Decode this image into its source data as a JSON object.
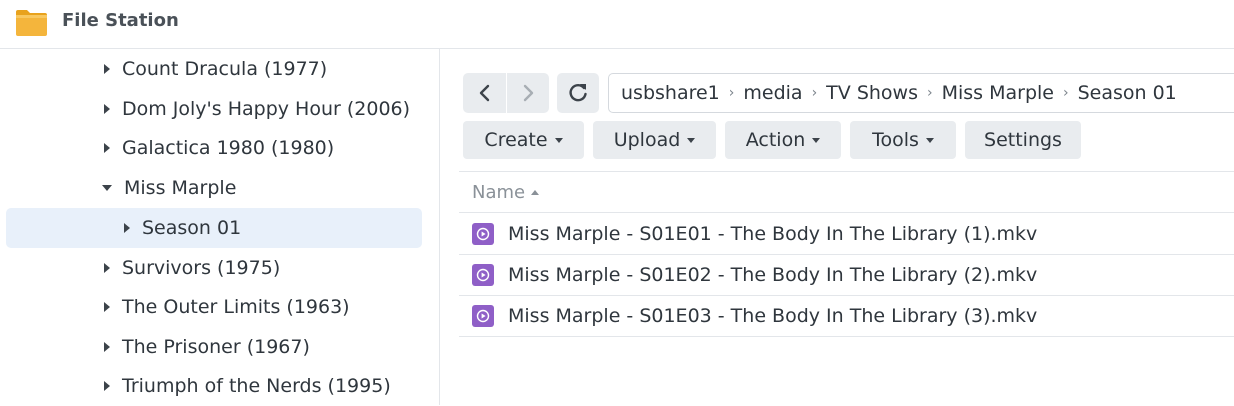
{
  "app": {
    "title": "File Station"
  },
  "tree": {
    "items": [
      {
        "label": "Count Dracula (1977)",
        "state": "collapsed"
      },
      {
        "label": "Dom Joly's Happy Hour (2006)",
        "state": "collapsed"
      },
      {
        "label": "Galactica 1980 (1980)",
        "state": "collapsed"
      },
      {
        "label": "Miss Marple",
        "state": "expanded"
      },
      {
        "label": "Season 01",
        "state": "collapsed",
        "selected": true
      },
      {
        "label": "Survivors (1975)",
        "state": "collapsed"
      },
      {
        "label": "The Outer Limits (1963)",
        "state": "collapsed"
      },
      {
        "label": "The Prisoner (1967)",
        "state": "collapsed"
      },
      {
        "label": "Triumph of the Nerds (1995)",
        "state": "collapsed"
      }
    ]
  },
  "navigation": {
    "back_icon": "chevron-left-icon",
    "forward_icon": "chevron-right-icon",
    "refresh_icon": "refresh-icon"
  },
  "breadcrumb": [
    "usbshare1",
    "media",
    "TV Shows",
    "Miss Marple",
    "Season 01"
  ],
  "toolbar": {
    "create": "Create",
    "upload": "Upload",
    "action": "Action",
    "tools": "Tools",
    "settings": "Settings"
  },
  "file_list": {
    "column_name": "Name",
    "files": [
      "Miss Marple - S01E01 - The Body In The Library (1).mkv",
      "Miss Marple - S01E02 - The Body In The Library (2).mkv",
      "Miss Marple - S01E03 - The Body In The Library (3).mkv"
    ]
  },
  "colors": {
    "accent_video": "#8f5fc7",
    "selection": "#e8f0fa",
    "button_bg": "#e9ecef"
  }
}
